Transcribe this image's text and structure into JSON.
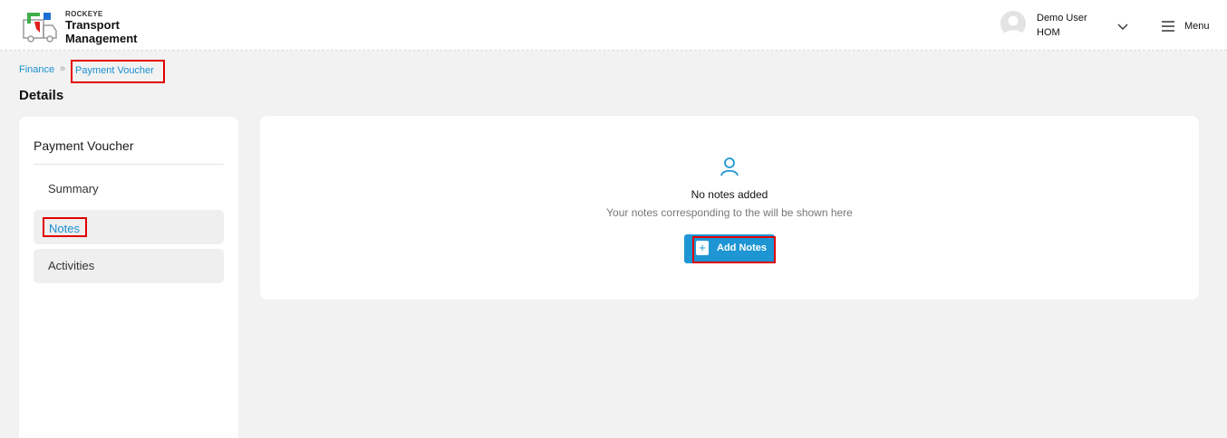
{
  "header": {
    "brand_small": "ROCKEYE",
    "brand_line1": "Transport",
    "brand_line2": "Management",
    "user_name": "Demo User",
    "user_role": "HOM",
    "menu_label": "Menu"
  },
  "breadcrumb": {
    "parent": "Finance",
    "separator": "»",
    "current": "Payment Voucher"
  },
  "page": {
    "title": "Details"
  },
  "sidebar": {
    "title": "Payment Voucher",
    "items": [
      {
        "label": "Summary"
      },
      {
        "label": "Notes"
      },
      {
        "label": "Activities"
      }
    ]
  },
  "notes": {
    "empty_title": "No notes added",
    "empty_subtitle": "Your notes corresponding to the will be shown here",
    "add_button_label": "Add Notes",
    "add_button_icon": "+"
  },
  "colors": {
    "accent": "#1e96d3",
    "link": "#1a8fd0",
    "highlight": "#e00000",
    "background": "#f2f2f2"
  },
  "icons": {
    "logo": "rockeye-logo-icon",
    "avatar": "user-avatar-icon",
    "chevron": "chevron-down-icon",
    "menu": "hamburger-menu-icon",
    "empty": "user-outline-icon",
    "add": "plus-icon"
  }
}
